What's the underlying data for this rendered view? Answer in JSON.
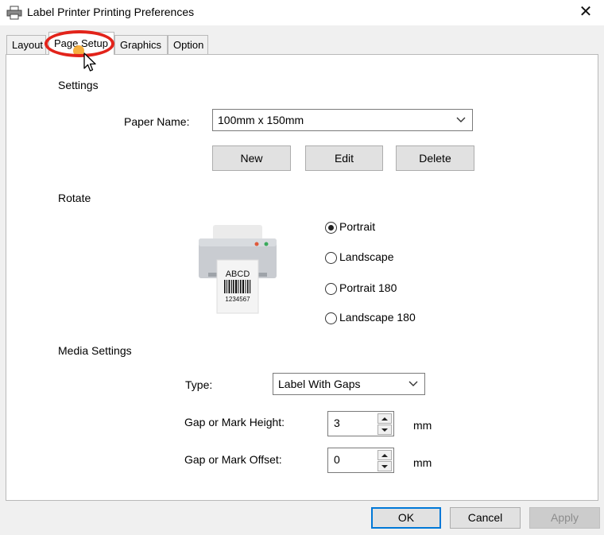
{
  "window": {
    "title": "Label Printer Printing Preferences",
    "close_glyph": "✕"
  },
  "tabs": [
    {
      "label": "Layout",
      "active": false
    },
    {
      "label": "Page Setup",
      "active": true
    },
    {
      "label": "Graphics",
      "active": false
    },
    {
      "label": "Option",
      "active": false
    }
  ],
  "settings": {
    "group_label": "Settings",
    "paper_name_label": "Paper Name:",
    "paper_name_value": "100mm x 150mm",
    "buttons": {
      "new": "New",
      "edit": "Edit",
      "delete": "Delete"
    }
  },
  "rotate": {
    "group_label": "Rotate",
    "preview": {
      "label_text": "ABCD",
      "barcode_number": "1234567"
    },
    "options": [
      {
        "label": "Portrait",
        "selected": true
      },
      {
        "label": "Landscape",
        "selected": false
      },
      {
        "label": "Portrait 180",
        "selected": false
      },
      {
        "label": "Landscape 180",
        "selected": false
      }
    ]
  },
  "media": {
    "group_label": "Media Settings",
    "type_label": "Type:",
    "type_value": "Label With Gaps",
    "gap_height_label": "Gap or Mark Height:",
    "gap_height_value": "3",
    "gap_height_unit": "mm",
    "gap_offset_label": "Gap or Mark Offset:",
    "gap_offset_value": "0",
    "gap_offset_unit": "mm"
  },
  "footer": {
    "ok": "OK",
    "cancel": "Cancel",
    "apply": "Apply"
  },
  "colors": {
    "highlight_ring": "#e2231a",
    "accent": "#0078d7"
  }
}
